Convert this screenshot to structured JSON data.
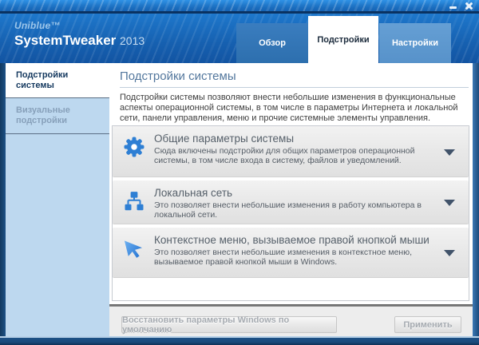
{
  "window": {
    "controls": {
      "minimize": "minimize-icon",
      "close": "close-icon"
    }
  },
  "header": {
    "brand": "Uniblue™",
    "product": "SystemTweaker",
    "year": "2013"
  },
  "tabs": [
    {
      "label": "Обзор",
      "active": false
    },
    {
      "label": "Подстройки",
      "active": true
    },
    {
      "label": "Настройки",
      "active": false
    }
  ],
  "sidebar": {
    "items": [
      {
        "label": "Подстройки системы",
        "active": true
      },
      {
        "label": "Визуальные подстройки",
        "active": false
      }
    ]
  },
  "main": {
    "title": "Подстройки системы",
    "description": "Подстройки системы позволяют внести небольшие изменения в функциональные аспекты операционной системы, в том числе в параметры Интернета и локальной сети, панели управления, меню и прочие системные элементы управления.",
    "cards": [
      {
        "icon": "gear-icon",
        "title": "Общие параметры системы",
        "description": "Сюда включены подстройки для общих параметров операционной системы, в том числе входа в систему, файлов и уведомлений."
      },
      {
        "icon": "network-icon",
        "title": "Локальная сеть",
        "description": "Это позволяет внести небольшие изменения в работу компьютера в локальной сети."
      },
      {
        "icon": "cursor-icon",
        "title": "Контекстное меню, вызываемое правой кнопкой мыши",
        "description": "Это позволяет внести небольшие изменения в контекстное меню, вызываемое правой кнопкой мыши в Windows."
      }
    ]
  },
  "footer": {
    "restore_button": "Восстановить параметры Windows по умолчанию",
    "apply_button": "Применить"
  },
  "colors": {
    "accent_blue": "#2e7fd4",
    "titlebar_blue": "#1c70c2",
    "header_blue": "#1660b0",
    "sidebar_bg": "#bdd8ef",
    "tab_overview_bg": "#2d6fae",
    "tab_settings_bg": "#5792ca",
    "active_tab_text": "#1b2b3c",
    "heading_text": "#53779d",
    "disabled_button_text": "#a6abb1"
  }
}
